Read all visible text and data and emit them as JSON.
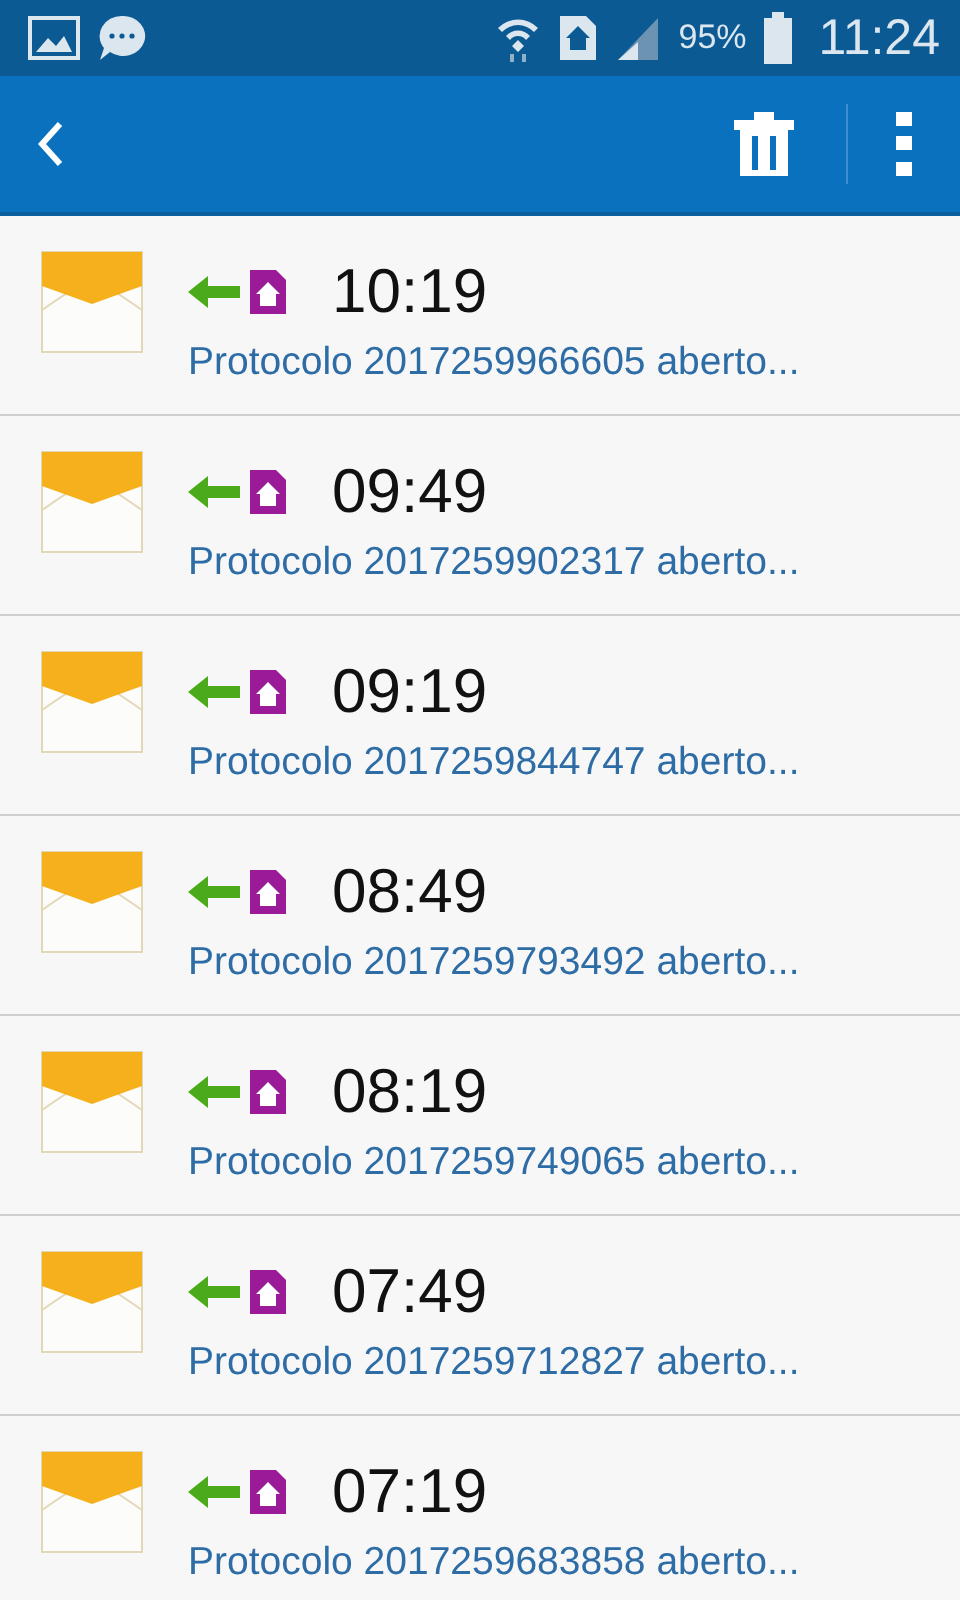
{
  "status_bar": {
    "battery": "95%",
    "time": "11:24"
  },
  "messages": [
    {
      "time": "10:19",
      "preview": "Protocolo 2017259966605 aberto..."
    },
    {
      "time": "09:49",
      "preview": "Protocolo 2017259902317 aberto..."
    },
    {
      "time": "09:19",
      "preview": "Protocolo 2017259844747 aberto..."
    },
    {
      "time": "08:49",
      "preview": "Protocolo 2017259793492 aberto..."
    },
    {
      "time": "08:19",
      "preview": "Protocolo 2017259749065 aberto..."
    },
    {
      "time": "07:49",
      "preview": "Protocolo 2017259712827 aberto..."
    },
    {
      "time": "07:19",
      "preview": "Protocolo 2017259683858 aberto..."
    }
  ]
}
